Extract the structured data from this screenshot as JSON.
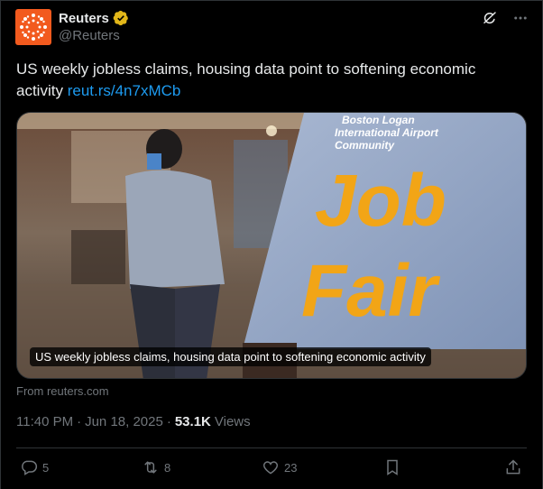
{
  "author": {
    "name": "Reuters",
    "handle": "@Reuters",
    "verified": true,
    "brand_color": "#f25a1e",
    "badge_color": "#e2b719"
  },
  "post": {
    "text": "US weekly jobless claims, housing data point to softening economic activity",
    "link": "reut.rs/4n7xMCb"
  },
  "media": {
    "caption": "US weekly jobless claims, housing data point to softening economic activity",
    "sign_lines": [
      "Boston Logan",
      "International Airport",
      "Community"
    ],
    "sign_big": [
      "Job",
      "Fair"
    ],
    "sign_text_color": "#f2a516",
    "sign_bg_color": "#8ea2c4"
  },
  "source": "From reuters.com",
  "meta": {
    "time": "11:40 PM",
    "date": "Jun 18, 2025",
    "separator": "·",
    "views_count": "53.1K",
    "views_label": "Views"
  },
  "actions": {
    "replies": "5",
    "reposts": "8",
    "likes": "23"
  },
  "icons": [
    "grok-icon",
    "more-icon",
    "verified-badge-icon",
    "reply-icon",
    "repost-icon",
    "like-icon",
    "bookmark-icon",
    "share-icon"
  ]
}
